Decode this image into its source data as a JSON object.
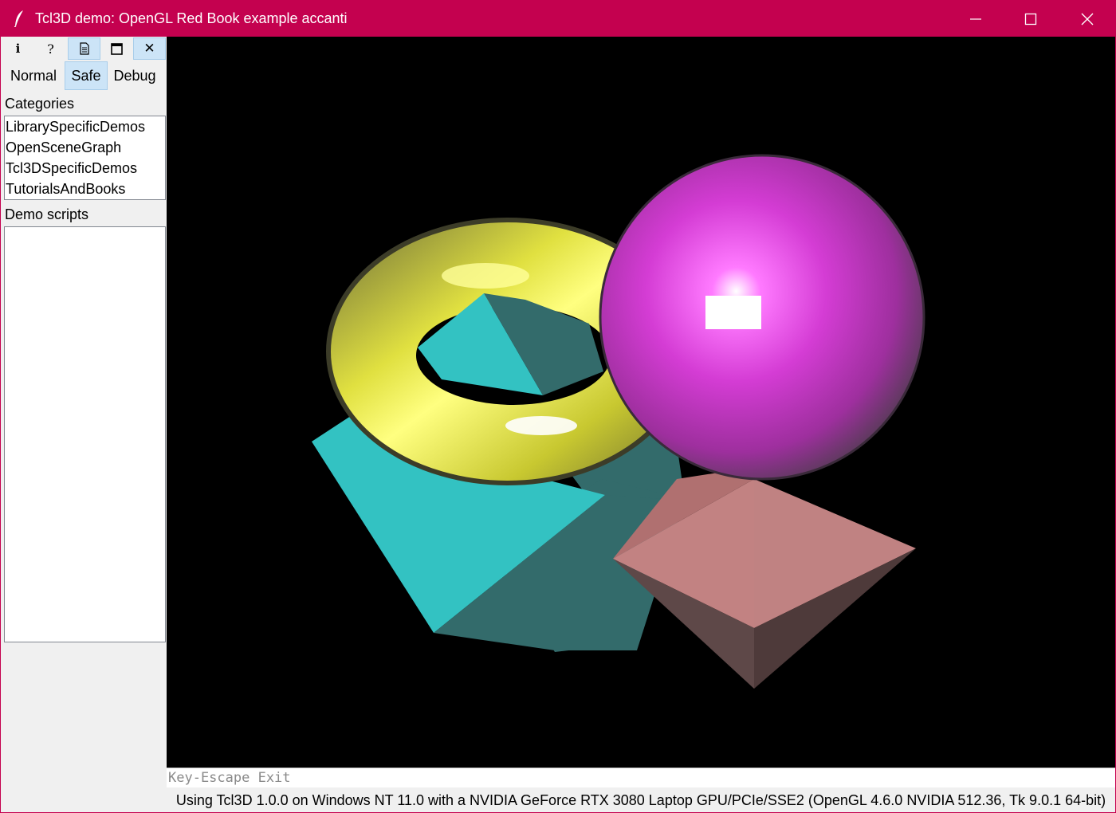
{
  "window": {
    "title": "Tcl3D demo: OpenGL Red Book example accanti",
    "app_icon": "feather-icon",
    "controls": [
      "minimize-icon",
      "maximize-icon",
      "close-icon"
    ]
  },
  "toolbar": {
    "buttons": [
      {
        "name": "info",
        "glyph": "i"
      },
      {
        "name": "help",
        "glyph": "?"
      },
      {
        "name": "source",
        "icon": "document-icon"
      },
      {
        "name": "fullscreen",
        "icon": "window-icon"
      },
      {
        "name": "close",
        "glyph": "✕"
      }
    ]
  },
  "modes": {
    "items": [
      "Normal",
      "Safe",
      "Debug"
    ],
    "selected": "Safe"
  },
  "categories": {
    "label": "Categories",
    "items": [
      "LibrarySpecificDemos",
      "OpenSceneGraph",
      "Tcl3DSpecificDemos",
      "TutorialsAndBooks"
    ]
  },
  "demo_scripts": {
    "label": "Demo scripts",
    "items": []
  },
  "status": {
    "keys": "Key-Escape Exit",
    "info": "Using Tcl3D 1.0.0 on Windows NT 11.0 with a NVIDIA GeForce RTX 3080 Laptop GPU/PCIe/SSE2 (OpenGL 4.6.0 NVIDIA 512.36, Tk 9.0.1 64-bit)"
  },
  "colors": {
    "titlebar": "#c4014f",
    "selection": "#cce4f7",
    "torus": "#d9d93a",
    "cube": "#33c2c2",
    "sphere": "#d84fd8",
    "octahedron": "#c28282",
    "viewport_bg": "#000000"
  }
}
